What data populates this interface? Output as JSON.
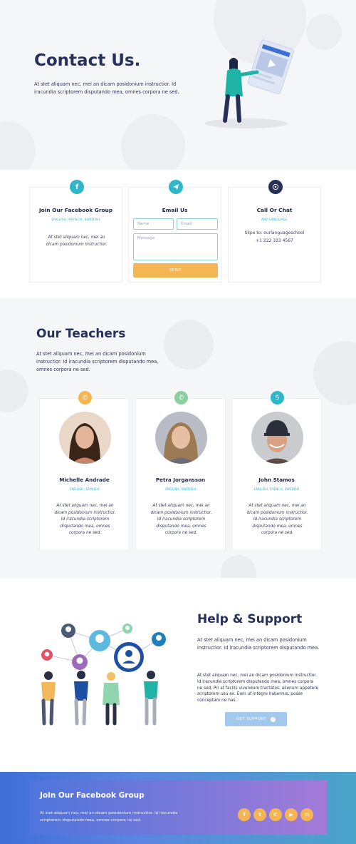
{
  "hero": {
    "title": "Contact Us.",
    "text": "At stet aliquam nec, mei an dicam posidonium instructior. Id iracundia scriptorem disputando mea, omnes corpora ne sed."
  },
  "contact": {
    "facebook": {
      "icon": "facebook-icon",
      "title": "Join Our Facebook Group",
      "subtitle": "ENGLISH, FRENCH, SWEDISH",
      "text": "At stet aliquam nec, mei an dicam posidonium instructior."
    },
    "email": {
      "icon": "telegram-icon",
      "title": "Email Us",
      "name_placeholder": "Name",
      "email_placeholder": "Email",
      "message_placeholder": "Message",
      "send_label": "SEND"
    },
    "call": {
      "icon": "whatsapp-icon",
      "title": "Call Or Chat",
      "subtitle": "ANY LANGUAGE",
      "skype": "Skpe to: ourlanguageschool",
      "phone": "+1 222 333 4567"
    }
  },
  "teachers": {
    "title": "Our Teachers",
    "text": "At stet aliquam nec, mei an dicam posidonium instructior. Id iracundia scriptorem disputando mea, omnes corpora ne sed.",
    "items": [
      {
        "name": "Michelle Andrade",
        "langs": "ENGLISH, SPANISH",
        "desc": "At stet aliquam nec, mei an dicam posidonium instructior. Id iracundia scriptorem disputando mea, omnes corpora ne sed.",
        "icon": "whatsapp-icon",
        "icon_color": "#f5b553"
      },
      {
        "name": "Petra Jorgansson",
        "langs": "ENGLISH, SWEDISH",
        "desc": "At stet aliquam nec, mei an dicam posidonium instructior. Id iracundia scriptorem disputando mea, omnes corpora ne sed.",
        "icon": "whatsapp-icon",
        "icon_color": "#8ccf9f"
      },
      {
        "name": "John Stamos",
        "langs": "ENGLISH, FRENCH, SWEDISH",
        "desc": "At stet aliquam nec, mei an dicam posidonium instructior. Id iracundia scriptorem disputando mea, omnes corpora ne sed.",
        "icon": "skype-icon",
        "icon_color": "#2fb6c9"
      }
    ]
  },
  "help": {
    "title": "Help & Support",
    "p1": "At stet aliquam nec, mei an dicam posidonium instructior. Id iracundia scriptorem disputando mea.",
    "p2": "At stet aliquam nec, mei an dicam posidonium instructior. Id iracundia scriptorem disputando mea, omnes corpora ne sed. Pri at facilis vivendum tractatos, alienum appetere scriptorem usu ex. Eam ut integre habemus, posse conceptam ne has.",
    "button_label": "GET SUPPORT"
  },
  "footer": {
    "title": "Join Our Facebook Group",
    "text": "At stet aliquam nec, mei an dicam posidonium instructior. Id iracundia scriptorem disputando mea, omnes corpora ne sed.",
    "socials": [
      "facebook-icon",
      "twitter-icon",
      "whatsapp-icon",
      "youtube-icon",
      "wechat-icon"
    ]
  },
  "colors": {
    "accent_teal": "#2fb6c9",
    "accent_orange": "#f5b553",
    "navy": "#26305a",
    "facebook_blue": "#2fb6c9",
    "dark_icon": "#26305a"
  }
}
